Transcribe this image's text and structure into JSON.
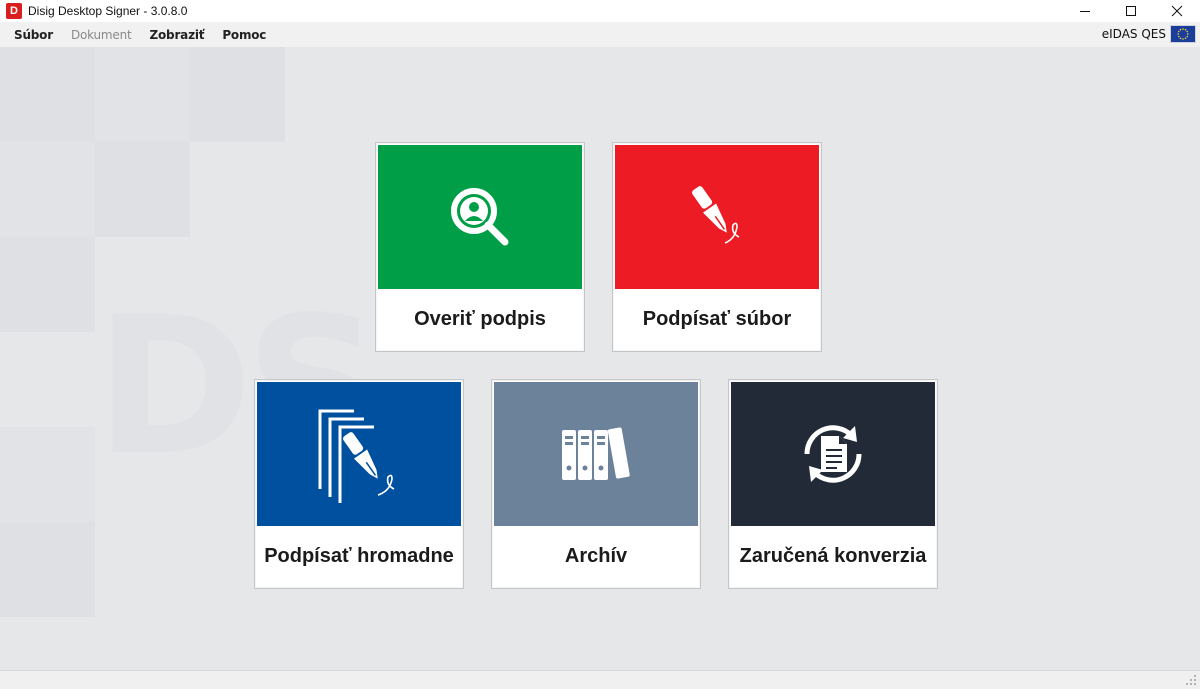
{
  "window": {
    "title": "Disig Desktop Signer - 3.0.8.0",
    "logo_letter": "D"
  },
  "menu": {
    "items": [
      {
        "label": "Súbor",
        "enabled": true
      },
      {
        "label": "Dokument",
        "enabled": false
      },
      {
        "label": "Zobraziť",
        "enabled": true
      },
      {
        "label": "Pomoc",
        "enabled": true
      }
    ],
    "eidas_label": "eIDAS QES"
  },
  "background": {
    "watermark": "DS"
  },
  "tiles": [
    {
      "label": "Overiť podpis",
      "color": "#009e47",
      "icon": "magnifier-person-icon"
    },
    {
      "label": "Podpísať súbor",
      "color": "#ed1c24",
      "icon": "fountain-pen-icon"
    },
    {
      "label": "Podpísať hromadne",
      "color": "#0050a0",
      "icon": "batch-sign-icon"
    },
    {
      "label": "Archív",
      "color": "#6c829a",
      "icon": "archive-binders-icon"
    },
    {
      "label": "Zaručená konverzia",
      "color": "#232a37",
      "icon": "document-convert-icon"
    }
  ],
  "colors": {
    "background": "#e6e7e9",
    "logo_red": "#d81e1e",
    "eu_blue": "#1a3e9a"
  }
}
